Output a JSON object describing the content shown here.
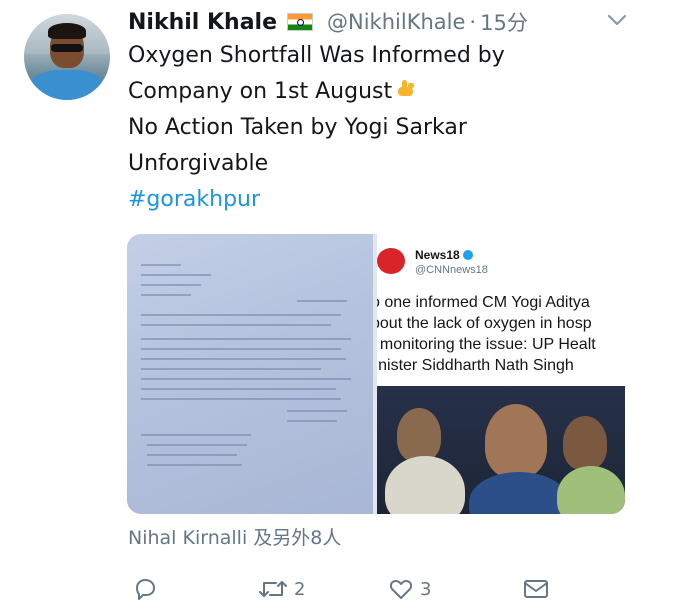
{
  "author": {
    "name": "Nikhil Khale",
    "flag_icon": "india-flag-icon",
    "handle": "@NikhilKhale",
    "separator": "·",
    "time": "15分"
  },
  "tweet": {
    "lines": [
      "Oxygen Shortfall Was Informed by",
      "Company on 1st August",
      "No Action Taken by Yogi Sarkar",
      "Unforgivable"
    ],
    "emoji_icon": "pointing-down-hand-icon",
    "hashtag": "#gorakhpur"
  },
  "media": {
    "left_image": "handwritten-letter-photo",
    "embedded_tweet": {
      "account_name": "News18",
      "account_handle": "@CNNnews18",
      "text_lines": [
        "o one informed CM Yogi Aditya",
        "bout the lack of oxygen in hosp",
        "; monitoring the issue: UP Healt",
        "linister Siddharth Nath Singh"
      ]
    }
  },
  "liked_by": "Nihal Kirnalli 及另外8人",
  "actions": {
    "reply_count": "",
    "retweet_count": "2",
    "like_count": "3",
    "message_count": ""
  },
  "colors": {
    "text": "#14171a",
    "muted": "#657786",
    "link": "#1b95e0"
  }
}
